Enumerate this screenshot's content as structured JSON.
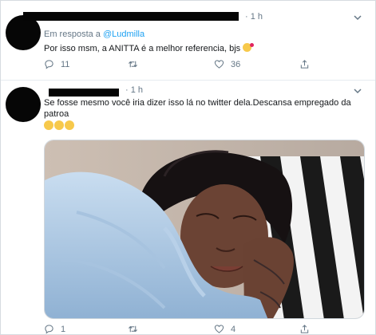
{
  "tweet_1": {
    "time": "· 1 h",
    "reply_prefix": "Em resposta a",
    "reply_handle": "@Ludmilla",
    "text": "Por isso msm, a ANITTA é a melhor referencia, bjs",
    "emoji": "face-blowing-kiss",
    "counts": {
      "reply": "11",
      "retweet": "",
      "like": "36",
      "share": ""
    }
  },
  "tweet_2": {
    "time": "· 1 h",
    "text": "Se fosse mesmo você iria dizer isso lá no twitter dela.Descansa empregado da patroa",
    "emojis": [
      "sleeping-face",
      "sleeping-face",
      "sleeping-face"
    ],
    "media": {
      "description_icon": "photo-woman-sleeping"
    },
    "counts": {
      "reply": "1",
      "retweet": "",
      "like": "4",
      "share": ""
    }
  },
  "icons": {
    "reply": "reply-icon",
    "retweet": "retweet-icon",
    "like": "heart-icon",
    "share": "share-icon",
    "menu": "chevron-down-icon"
  },
  "colors": {
    "link": "#1da1f2",
    "muted": "#657786",
    "text": "#14171a"
  }
}
